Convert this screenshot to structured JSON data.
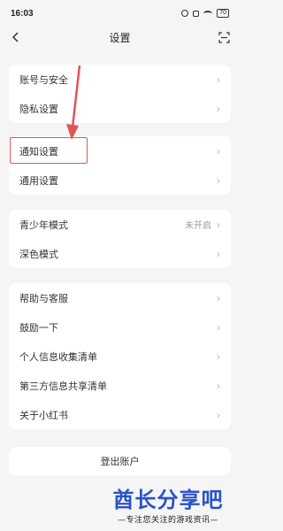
{
  "status_bar": {
    "time": "16:03",
    "battery": "70",
    "icons": [
      "alarm-icon",
      "nfc-icon",
      "wifi-icon",
      "battery-icon"
    ]
  },
  "nav": {
    "title": "设置",
    "back_icon": "chevron-left-icon",
    "scan_icon": "scan-icon"
  },
  "groups": {
    "account": {
      "items": [
        {
          "label": "账号与安全"
        },
        {
          "label": "隐私设置"
        }
      ]
    },
    "general": {
      "items": [
        {
          "label": "通知设置"
        },
        {
          "label": "通用设置"
        }
      ]
    },
    "display": {
      "items": [
        {
          "label": "青少年模式",
          "value": "未开启"
        },
        {
          "label": "深色模式"
        }
      ]
    },
    "help": {
      "items": [
        {
          "label": "帮助与客服"
        },
        {
          "label": "鼓励一下"
        },
        {
          "label": "个人信息收集清单"
        },
        {
          "label": "第三方信息共享清单"
        },
        {
          "label": "关于小红书"
        }
      ]
    }
  },
  "logout_label": "登出账户",
  "watermark": {
    "title": "酋长分享吧",
    "subtitle": "—专注您关注的游戏资讯—"
  },
  "colors": {
    "highlight": "#e05555",
    "watermark": "#2a53c8",
    "background": "#f5f5f5"
  }
}
